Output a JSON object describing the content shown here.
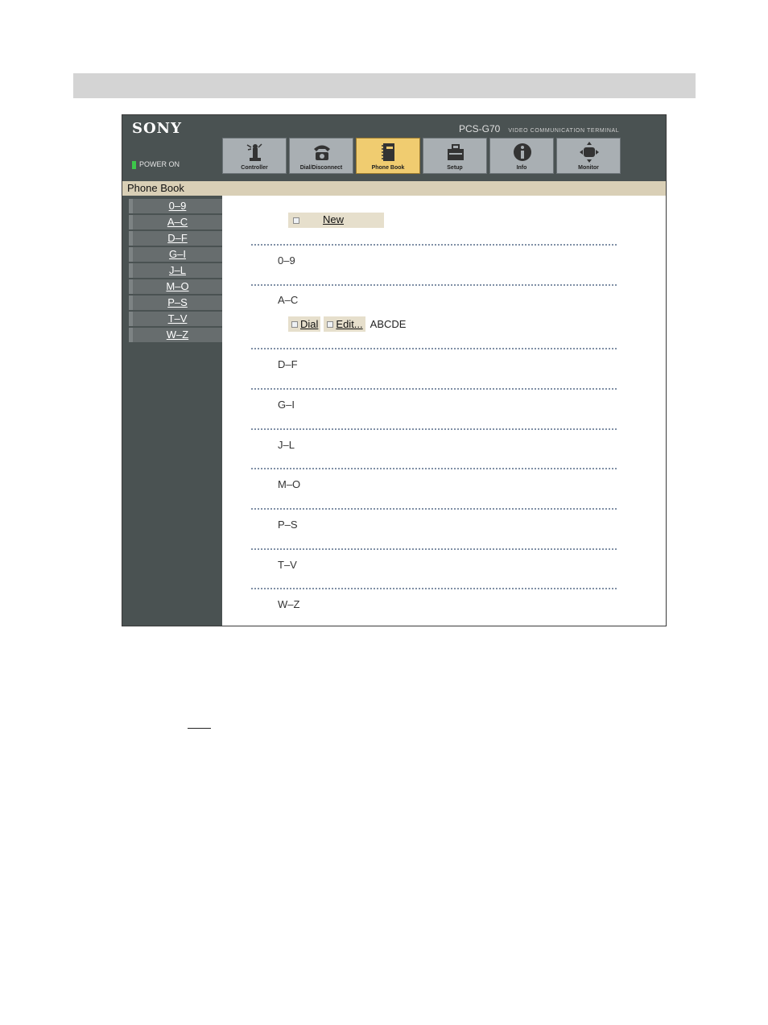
{
  "brand": "SONY",
  "model": "PCS-G70",
  "model_subtitle": "VIDEO COMMUNICATION TERMINAL",
  "power_status": "POWER ON",
  "tabs": [
    {
      "label": "Controller",
      "icon": "controller-icon"
    },
    {
      "label": "Dial/Disconnect",
      "icon": "telephone-icon"
    },
    {
      "label": "Phone Book",
      "icon": "phone-book-icon",
      "active": true
    },
    {
      "label": "Setup",
      "icon": "toolbox-icon"
    },
    {
      "label": "Info",
      "icon": "info-icon"
    },
    {
      "label": "Monitor",
      "icon": "monitor-arrows-icon"
    }
  ],
  "section_title": "Phone Book",
  "sidebar": {
    "items": [
      "0–9",
      "A–C",
      "D–F",
      "G–I",
      "J–L",
      "M–O",
      "P–S",
      "T–V",
      "W–Z"
    ]
  },
  "content": {
    "new_label": "New",
    "groups": [
      "0–9",
      "A–C",
      "D–F",
      "G–I",
      "J–L",
      "M–O",
      "P–S",
      "T–V",
      "W–Z"
    ],
    "entry": {
      "dial_label": "Dial",
      "edit_label": "Edit...",
      "name": "ABCDE"
    }
  },
  "colors": {
    "header_bg": "#4a5252",
    "active_tab": "#f0cc70",
    "section_bar": "#d9cfb6",
    "button_bg": "#e6dfcc",
    "power_led": "#3cc74a"
  }
}
